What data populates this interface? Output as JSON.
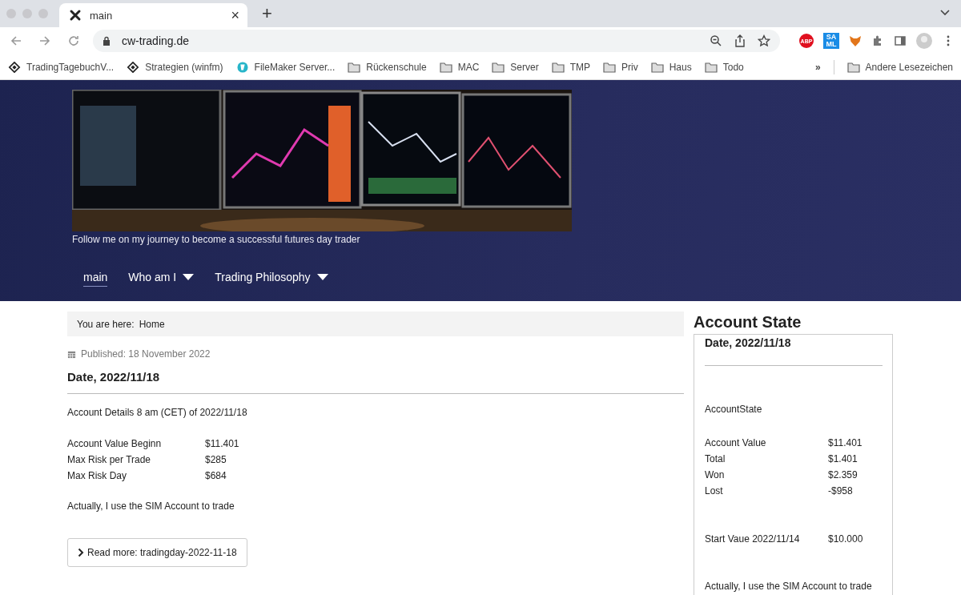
{
  "browser": {
    "tab": {
      "title": "main",
      "close": "×"
    },
    "new_tab": "+",
    "address": "cw-trading.de",
    "bookmarks": [
      {
        "label": "TradingTagebuchV...",
        "kind": "site"
      },
      {
        "label": "Strategien (winfm)",
        "kind": "site"
      },
      {
        "label": "FileMaker Server...",
        "kind": "app"
      },
      {
        "label": "Rückenschule",
        "kind": "folder"
      },
      {
        "label": "MAC",
        "kind": "folder"
      },
      {
        "label": "Server",
        "kind": "folder"
      },
      {
        "label": "TMP",
        "kind": "folder"
      },
      {
        "label": "Priv",
        "kind": "folder"
      },
      {
        "label": "Haus",
        "kind": "folder"
      },
      {
        "label": "Todo",
        "kind": "folder"
      }
    ],
    "more_bookmarks": "»",
    "other_bookmarks": "Andere Lesezeichen",
    "extensions": {
      "abp": "ABP",
      "saml": "SA ML"
    }
  },
  "header": {
    "tagline": "Follow me on my journey to become a successful futures day trader",
    "nav": [
      {
        "label": "main",
        "selected": true,
        "dropdown": false
      },
      {
        "label": "Who am I",
        "selected": false,
        "dropdown": true
      },
      {
        "label": "Trading Philosophy",
        "selected": false,
        "dropdown": true
      }
    ]
  },
  "breadcrumb": {
    "prefix": "You are here:",
    "current": "Home"
  },
  "article": {
    "published": "Published: 18 November 2022",
    "title": "Date, 2022/11/18",
    "intro": "Account Details 8 am (CET) of 2022/11/18",
    "rows": [
      {
        "label": "Account Value Beginn",
        "value": "$11.401"
      },
      {
        "label": "Max Risk per Trade",
        "value": "$285"
      },
      {
        "label": "Max Risk Day",
        "value": "$684"
      }
    ],
    "note": "Actually, I use the SIM Account to trade",
    "read_more": "Read more: tradingday-2022-11-18"
  },
  "sidebar": {
    "heading": "Account State",
    "card_title": "Date, 2022/11/18",
    "subtitle": "AccountState",
    "rows": [
      {
        "label": "Account Value",
        "value": "$11.401"
      },
      {
        "label": "Total",
        "value": "$1.401"
      },
      {
        "label": "Won",
        "value": "$2.359"
      },
      {
        "label": "Lost",
        "value": "-$958"
      }
    ],
    "start": {
      "label": "Start Vaue 2022/11/14",
      "value": "$10.000"
    },
    "note": "Actually, I use the SIM Account to trade"
  }
}
